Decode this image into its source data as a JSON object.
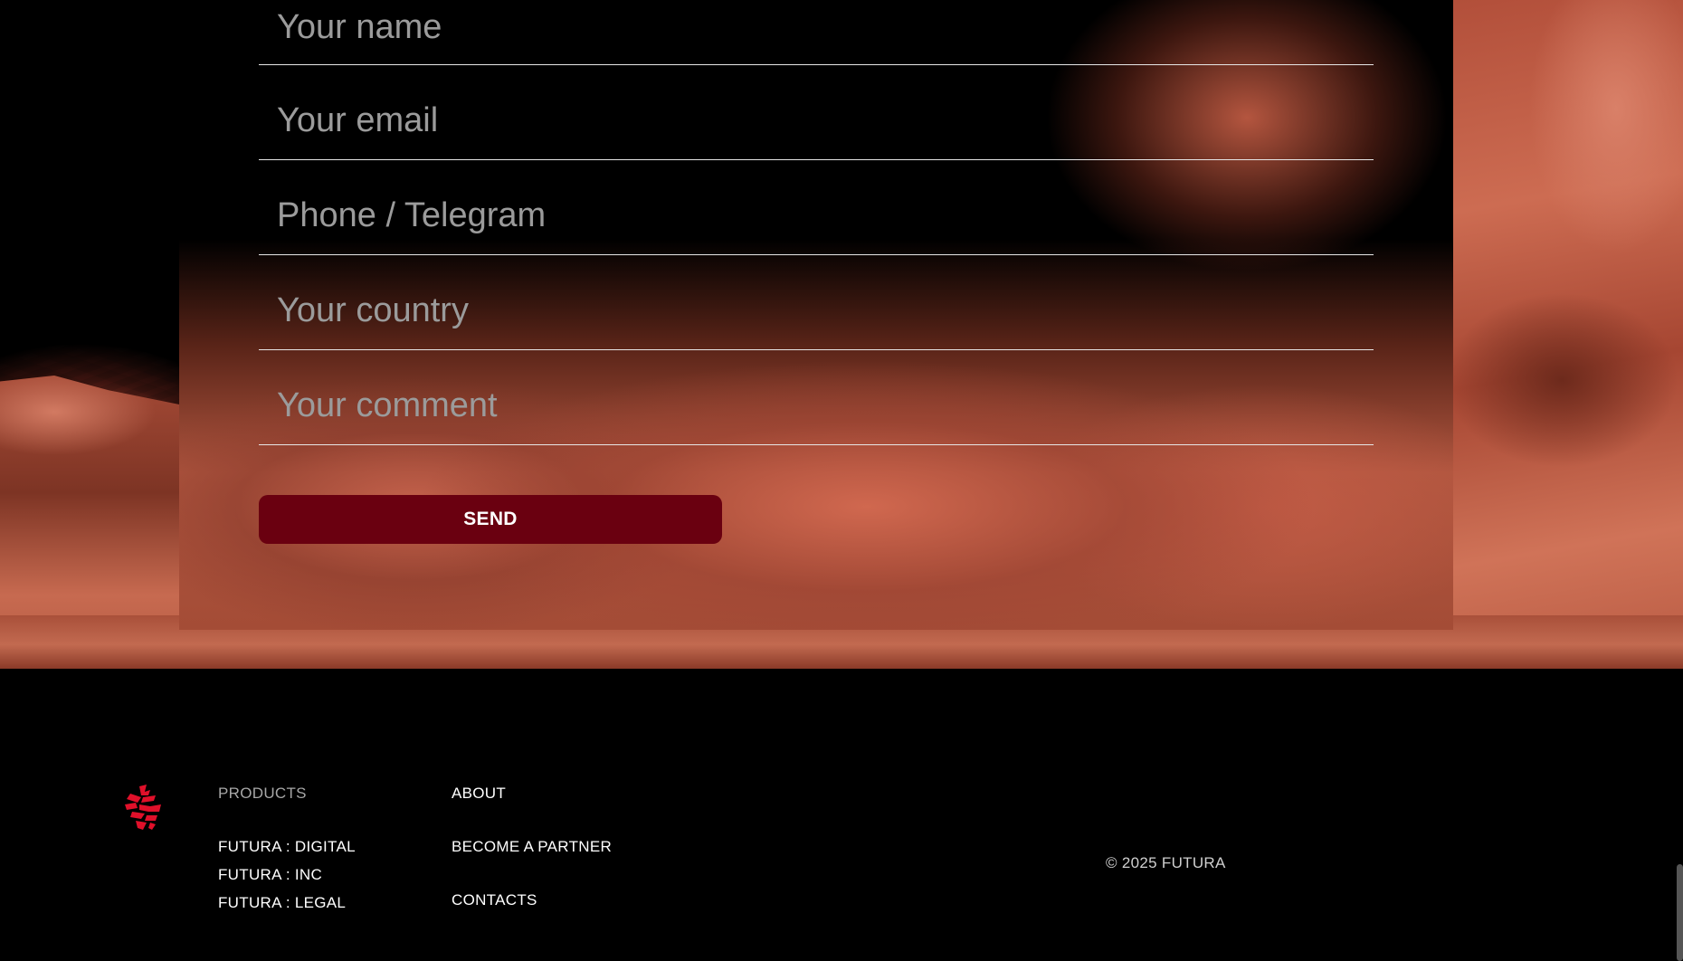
{
  "form": {
    "fields": [
      {
        "placeholder": "Your name",
        "value": ""
      },
      {
        "placeholder": "Your email",
        "value": ""
      },
      {
        "placeholder": "Phone / Telegram",
        "value": ""
      },
      {
        "placeholder": "Your country",
        "value": ""
      },
      {
        "placeholder": "Your comment",
        "value": ""
      }
    ],
    "send_label": "SEND"
  },
  "footer": {
    "logo_icon": "futura-logo-icon",
    "products": {
      "heading": "PRODUCTS",
      "links": [
        "FUTURA : DIGITAL",
        "FUTURA : INC",
        "FUTURA : LEGAL"
      ]
    },
    "about_links": [
      "ABOUT",
      "BECOME A PARTNER",
      "CONTACTS"
    ],
    "copyright": "©  2025 FUTURA"
  },
  "colors": {
    "accent": "#6a0010",
    "logo": "#e0102a",
    "background": "#000000"
  }
}
